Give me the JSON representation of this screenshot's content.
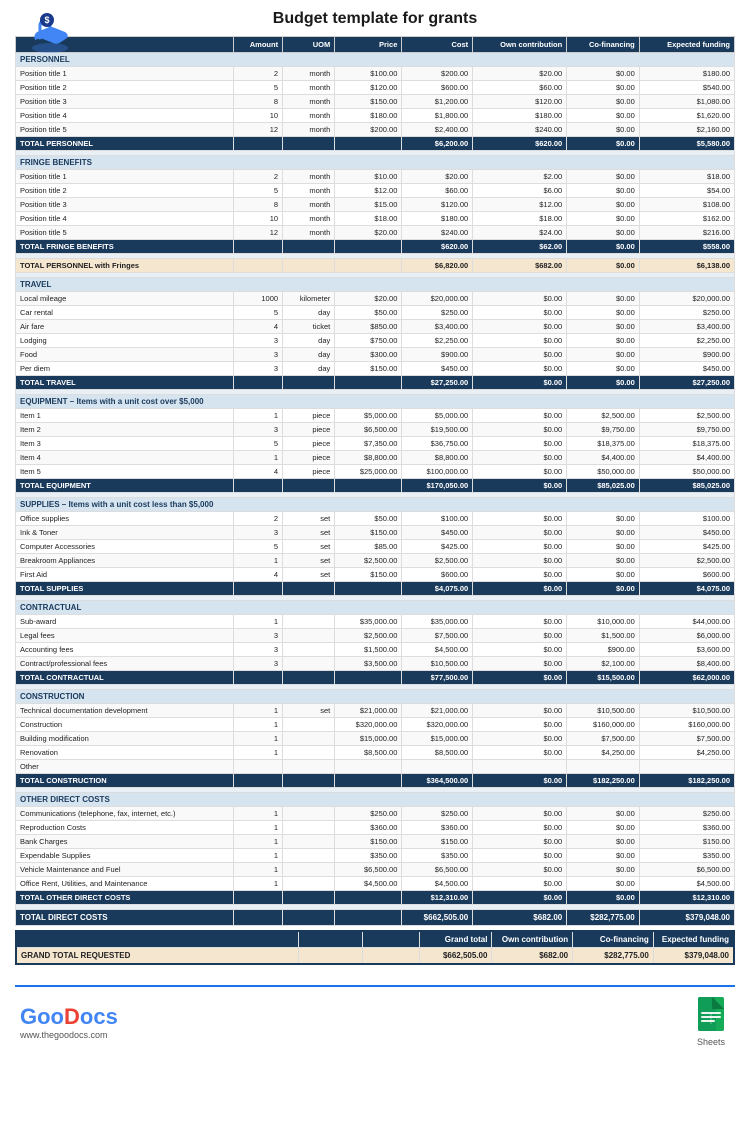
{
  "header": {
    "title": "Budget template for grants",
    "icon_label": "dollar-hand-icon"
  },
  "table": {
    "columns": [
      "",
      "Amount",
      "UOM",
      "Price",
      "Cost",
      "Own contribution",
      "Co-financing",
      "Expected funding"
    ],
    "sections": [
      {
        "name": "PERSONNEL",
        "rows": [
          [
            "Position title 1",
            "2",
            "month",
            "$100.00",
            "$200.00",
            "$20.00",
            "$0.00",
            "$180.00"
          ],
          [
            "Position title 2",
            "5",
            "month",
            "$120.00",
            "$600.00",
            "$60.00",
            "$0.00",
            "$540.00"
          ],
          [
            "Position title 3",
            "8",
            "month",
            "$150.00",
            "$1,200.00",
            "$120.00",
            "$0.00",
            "$1,080.00"
          ],
          [
            "Position title 4",
            "10",
            "month",
            "$180.00",
            "$1,800.00",
            "$180.00",
            "$0.00",
            "$1,620.00"
          ],
          [
            "Position title 5",
            "12",
            "month",
            "$200.00",
            "$2,400.00",
            "$240.00",
            "$0.00",
            "$2,160.00"
          ]
        ],
        "total_label": "TOTAL PERSONNEL",
        "total": [
          "",
          "",
          "",
          "$6,200.00",
          "$620.00",
          "$0.00",
          "$5,580.00"
        ]
      },
      {
        "name": "FRINGE BENEFITS",
        "rows": [
          [
            "Position title 1",
            "2",
            "month",
            "$10.00",
            "$20.00",
            "$2.00",
            "$0.00",
            "$18.00"
          ],
          [
            "Position title 2",
            "5",
            "month",
            "$12.00",
            "$60.00",
            "$6.00",
            "$0.00",
            "$54.00"
          ],
          [
            "Position title 3",
            "8",
            "month",
            "$15.00",
            "$120.00",
            "$12.00",
            "$0.00",
            "$108.00"
          ],
          [
            "Position title 4",
            "10",
            "month",
            "$18.00",
            "$180.00",
            "$18.00",
            "$0.00",
            "$162.00"
          ],
          [
            "Position title 5",
            "12",
            "month",
            "$20.00",
            "$240.00",
            "$24.00",
            "$0.00",
            "$216.00"
          ]
        ],
        "total_label": "TOTAL FRINGE BENEFITS",
        "total": [
          "",
          "",
          "",
          "$620.00",
          "$62.00",
          "$0.00",
          "$558.00"
        ]
      }
    ],
    "total_personnel_fringes": {
      "label": "TOTAL PERSONNEL with Fringes",
      "values": [
        "",
        "",
        "",
        "$6,820.00",
        "$682.00",
        "$0.00",
        "$6,138.00"
      ]
    },
    "travel_section": {
      "name": "TRAVEL",
      "rows": [
        [
          "Local mileage",
          "1000",
          "kilometer",
          "$20.00",
          "$20,000.00",
          "$0.00",
          "$0.00",
          "$20,000.00"
        ],
        [
          "Car rental",
          "5",
          "day",
          "$50.00",
          "$250.00",
          "$0.00",
          "$0.00",
          "$250.00"
        ],
        [
          "Air fare",
          "4",
          "ticket",
          "$850.00",
          "$3,400.00",
          "$0.00",
          "$0.00",
          "$3,400.00"
        ],
        [
          "Lodging",
          "3",
          "day",
          "$750.00",
          "$2,250.00",
          "$0.00",
          "$0.00",
          "$2,250.00"
        ],
        [
          "Food",
          "3",
          "day",
          "$300.00",
          "$900.00",
          "$0.00",
          "$0.00",
          "$900.00"
        ],
        [
          "Per diem",
          "3",
          "day",
          "$150.00",
          "$450.00",
          "$0.00",
          "$0.00",
          "$450.00"
        ]
      ],
      "total_label": "TOTAL TRAVEL",
      "total": [
        "",
        "",
        "",
        "$27,250.00",
        "$0.00",
        "$0.00",
        "$27,250.00"
      ]
    },
    "equipment_section": {
      "name": "EQUIPMENT – Items with a unit cost over $5,000",
      "rows": [
        [
          "Item 1",
          "1",
          "piece",
          "$5,000.00",
          "$5,000.00",
          "$0.00",
          "$2,500.00",
          "$2,500.00"
        ],
        [
          "Item 2",
          "3",
          "piece",
          "$6,500.00",
          "$19,500.00",
          "$0.00",
          "$9,750.00",
          "$9,750.00"
        ],
        [
          "Item 3",
          "5",
          "piece",
          "$7,350.00",
          "$36,750.00",
          "$0.00",
          "$18,375.00",
          "$18,375.00"
        ],
        [
          "Item 4",
          "1",
          "piece",
          "$8,800.00",
          "$8,800.00",
          "$0.00",
          "$4,400.00",
          "$4,400.00"
        ],
        [
          "Item 5",
          "4",
          "piece",
          "$25,000.00",
          "$100,000.00",
          "$0.00",
          "$50,000.00",
          "$50,000.00"
        ]
      ],
      "total_label": "TOTAL EQUIPMENT",
      "total": [
        "",
        "",
        "",
        "$170,050.00",
        "$0.00",
        "$85,025.00",
        "$85,025.00"
      ]
    },
    "supplies_section": {
      "name": "SUPPLIES – Items with a unit cost less than $5,000",
      "rows": [
        [
          "Office supplies",
          "2",
          "set",
          "$50.00",
          "$100.00",
          "$0.00",
          "$0.00",
          "$100.00"
        ],
        [
          "Ink & Toner",
          "3",
          "set",
          "$150.00",
          "$450.00",
          "$0.00",
          "$0.00",
          "$450.00"
        ],
        [
          "Computer Accessories",
          "5",
          "set",
          "$85.00",
          "$425.00",
          "$0.00",
          "$0.00",
          "$425.00"
        ],
        [
          "Breakroom Appliances",
          "1",
          "set",
          "$2,500.00",
          "$2,500.00",
          "$0.00",
          "$0.00",
          "$2,500.00"
        ],
        [
          "First Aid",
          "4",
          "set",
          "$150.00",
          "$600.00",
          "$0.00",
          "$0.00",
          "$600.00"
        ]
      ],
      "total_label": "TOTAL SUPPLIES",
      "total": [
        "",
        "",
        "",
        "$4,075.00",
        "$0.00",
        "$0.00",
        "$4,075.00"
      ]
    },
    "contractual_section": {
      "name": "CONTRACTUAL",
      "rows": [
        [
          "Sub-award",
          "1",
          "",
          "$35,000.00",
          "$35,000.00",
          "$0.00",
          "$10,000.00",
          "$44,000.00"
        ],
        [
          "Legal fees",
          "3",
          "",
          "$2,500.00",
          "$7,500.00",
          "$0.00",
          "$1,500.00",
          "$6,000.00"
        ],
        [
          "Accounting fees",
          "3",
          "",
          "$1,500.00",
          "$4,500.00",
          "$0.00",
          "$900.00",
          "$3,600.00"
        ],
        [
          "Contract/professional fees",
          "3",
          "",
          "$3,500.00",
          "$10,500.00",
          "$0.00",
          "$2,100.00",
          "$8,400.00"
        ]
      ],
      "total_label": "TOTAL CONTRACTUAL",
      "total": [
        "",
        "",
        "",
        "$77,500.00",
        "$0.00",
        "$15,500.00",
        "$62,000.00"
      ]
    },
    "construction_section": {
      "name": "CONSTRUCTION",
      "rows": [
        [
          "Technical documentation development",
          "1",
          "set",
          "$21,000.00",
          "$21,000.00",
          "$0.00",
          "$10,500.00",
          "$10,500.00"
        ],
        [
          "Construction",
          "1",
          "",
          "$320,000.00",
          "$320,000.00",
          "$0.00",
          "$160,000.00",
          "$160,000.00"
        ],
        [
          "Building modification",
          "1",
          "",
          "$15,000.00",
          "$15,000.00",
          "$0.00",
          "$7,500.00",
          "$7,500.00"
        ],
        [
          "Renovation",
          "1",
          "",
          "$8,500.00",
          "$8,500.00",
          "$0.00",
          "$4,250.00",
          "$4,250.00"
        ],
        [
          "Other",
          "",
          "",
          "",
          "",
          "",
          "",
          ""
        ]
      ],
      "total_label": "TOTAL CONSTRUCTION",
      "total": [
        "",
        "",
        "",
        "$364,500.00",
        "$0.00",
        "$182,250.00",
        "$182,250.00"
      ]
    },
    "other_direct_section": {
      "name": "OTHER DIRECT COSTS",
      "rows": [
        [
          "Communications (telephone, fax, internet, etc.)",
          "1",
          "",
          "$250.00",
          "$250.00",
          "$0.00",
          "$0.00",
          "$250.00"
        ],
        [
          "Reproduction Costs",
          "1",
          "",
          "$360.00",
          "$360.00",
          "$0.00",
          "$0.00",
          "$360.00"
        ],
        [
          "Bank Charges",
          "1",
          "",
          "$150.00",
          "$150.00",
          "$0.00",
          "$0.00",
          "$150.00"
        ],
        [
          "Expendable Supplies",
          "1",
          "",
          "$350.00",
          "$350.00",
          "$0.00",
          "$0.00",
          "$350.00"
        ],
        [
          "Vehicle Maintenance and Fuel",
          "1",
          "",
          "$6,500.00",
          "$6,500.00",
          "$0.00",
          "$0.00",
          "$6,500.00"
        ],
        [
          "Office Rent, Utilities, and Maintenance",
          "1",
          "",
          "$4,500.00",
          "$4,500.00",
          "$0.00",
          "$0.00",
          "$4,500.00"
        ]
      ],
      "total_label": "TOTAL OTHER DIRECT COSTS",
      "total": [
        "",
        "",
        "",
        "$12,310.00",
        "$0.00",
        "$0.00",
        "$12,310.00"
      ]
    },
    "total_direct_costs": {
      "label": "TOTAL DIRECT COSTS",
      "values": [
        "",
        "",
        "",
        "$662,505.00",
        "$682.00",
        "$282,775.00",
        "$379,048.00"
      ]
    },
    "grand_total": {
      "header_cols": [
        "",
        "",
        "",
        "Grand total",
        "Own contribution",
        "Co-financing",
        "Expected funding"
      ],
      "label": "GRAND TOTAL REQUESTED",
      "values": [
        "",
        "",
        "",
        "$662,505.00",
        "$682.00",
        "$282,775.00",
        "$379,048.00"
      ]
    }
  },
  "footer": {
    "logo_text": "GooDocs",
    "url": "www.thegoodocs.com",
    "sheets_label": "Sheets"
  }
}
